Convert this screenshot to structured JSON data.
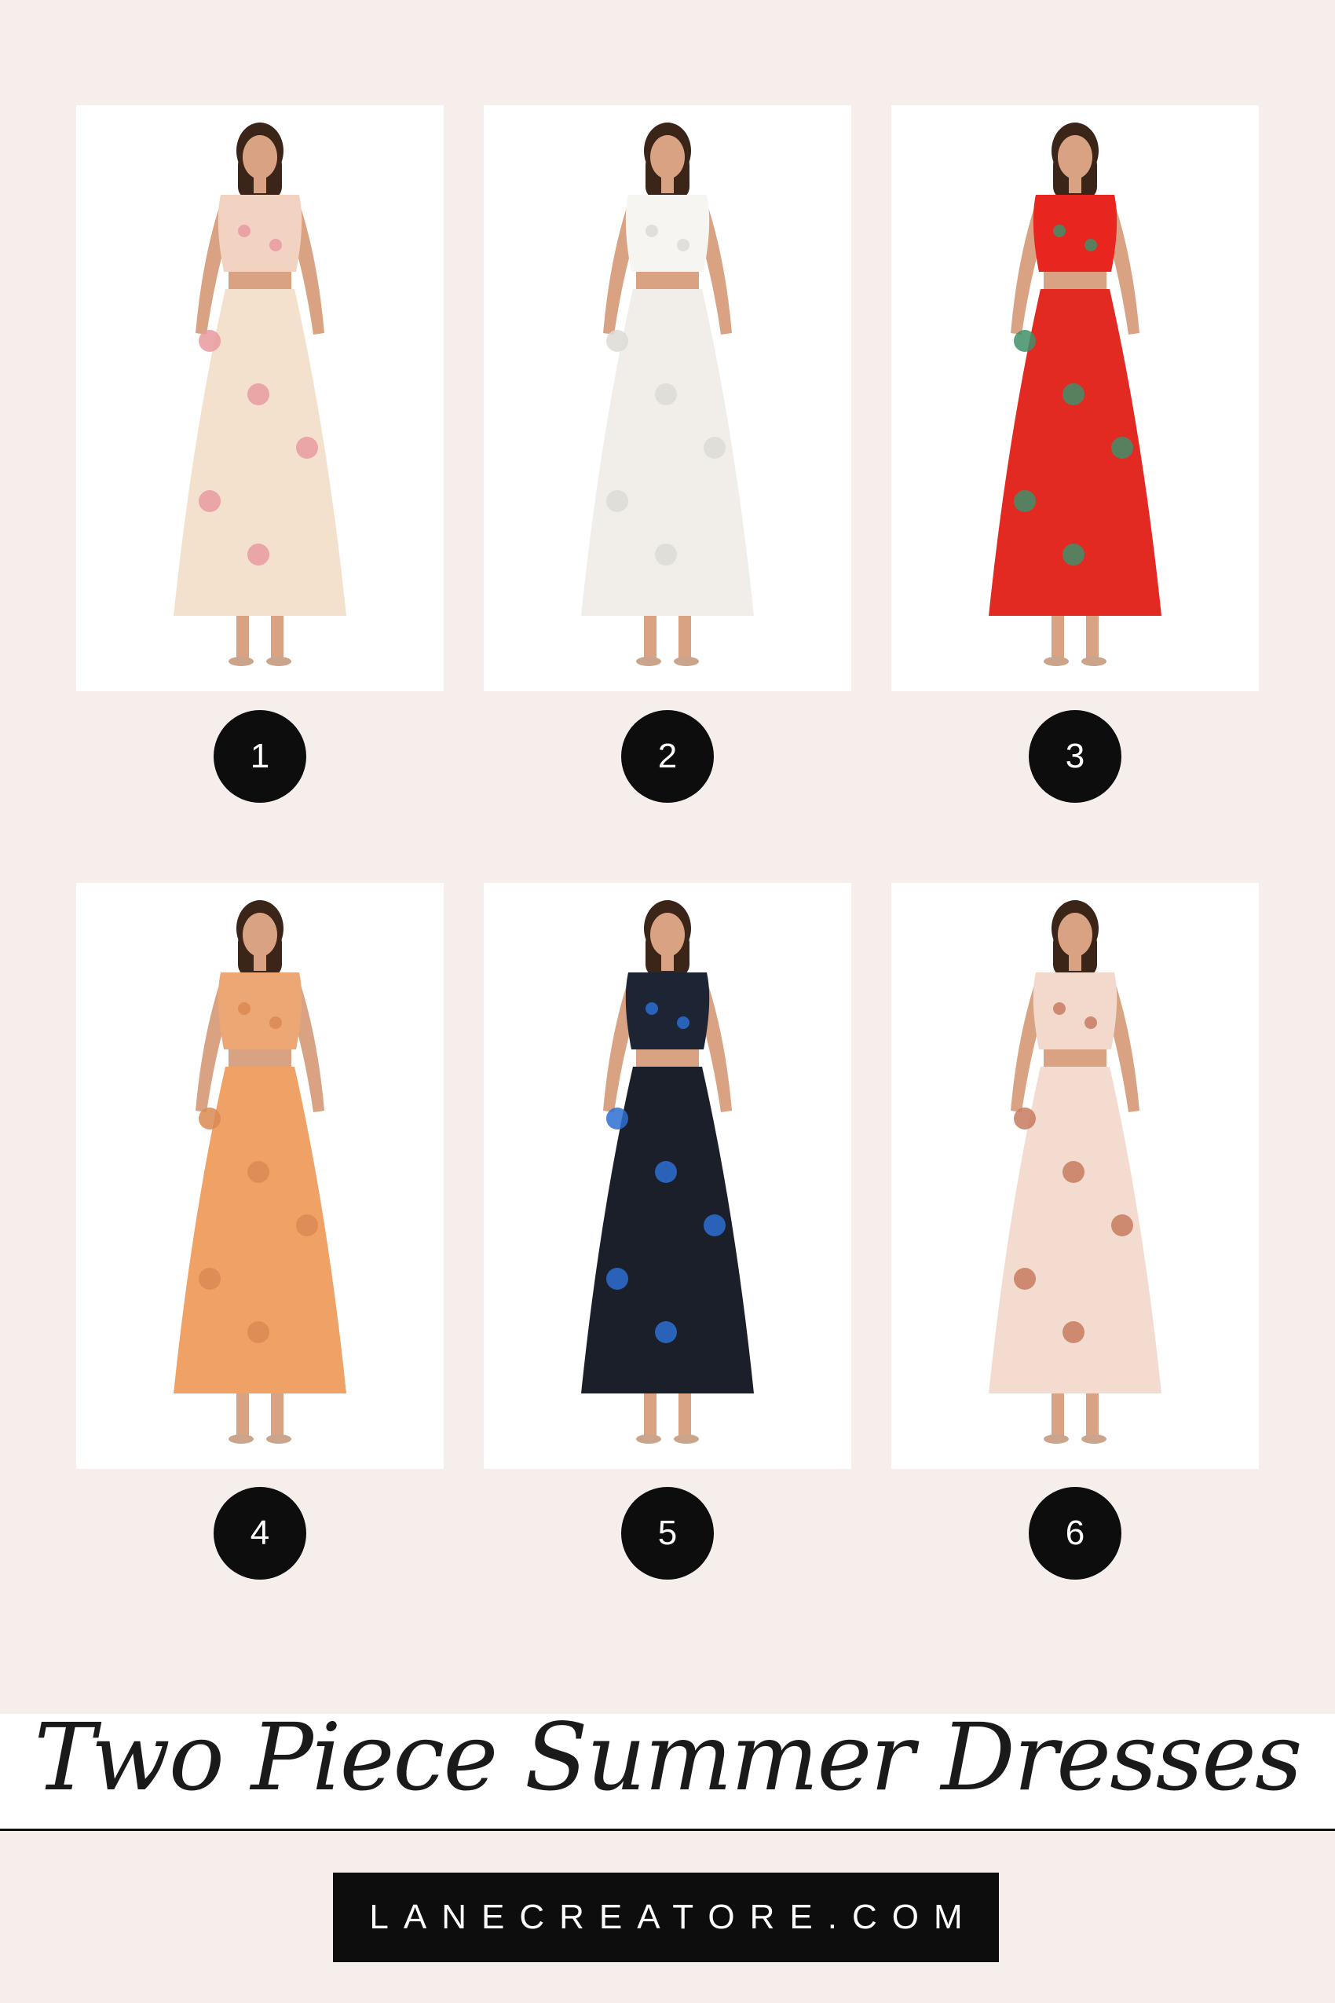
{
  "items": [
    {
      "number": "1",
      "image": "floral-two-piece-outfit-photo",
      "colors": {
        "top": "#f2d3c2",
        "skirt": "#f4e1cd",
        "accent": "#e79aa0"
      }
    },
    {
      "number": "2",
      "image": "white-two-piece-outfit-photo",
      "colors": {
        "top": "#f7f5f2",
        "skirt": "#f1eeea",
        "accent": "#dddad5"
      }
    },
    {
      "number": "3",
      "image": "red-floral-two-piece-outfit-photo",
      "colors": {
        "top": "#e8251f",
        "skirt": "#e22a22",
        "accent": "#3f8f68"
      }
    },
    {
      "number": "4",
      "image": "orange-two-piece-outfit-photo",
      "colors": {
        "top": "#eda774",
        "skirt": "#f0a266",
        "accent": "#d98a52"
      }
    },
    {
      "number": "5",
      "image": "black-floral-two-piece-outfit-photo",
      "colors": {
        "top": "#1d2433",
        "skirt": "#1b1f2a",
        "accent": "#2b6fd1"
      }
    },
    {
      "number": "6",
      "image": "striped-two-piece-outfit-photo",
      "colors": {
        "top": "#f2d9cc",
        "skirt": "#f3dccf",
        "accent": "#c77a60"
      }
    }
  ],
  "title": "Two Piece Summer Dresses",
  "website": "LANECREATORE.COM",
  "colors": {
    "background": "#f5eeea",
    "badge": "#0d0d0d",
    "skin": "#d9a383",
    "hair": "#3b2418"
  }
}
